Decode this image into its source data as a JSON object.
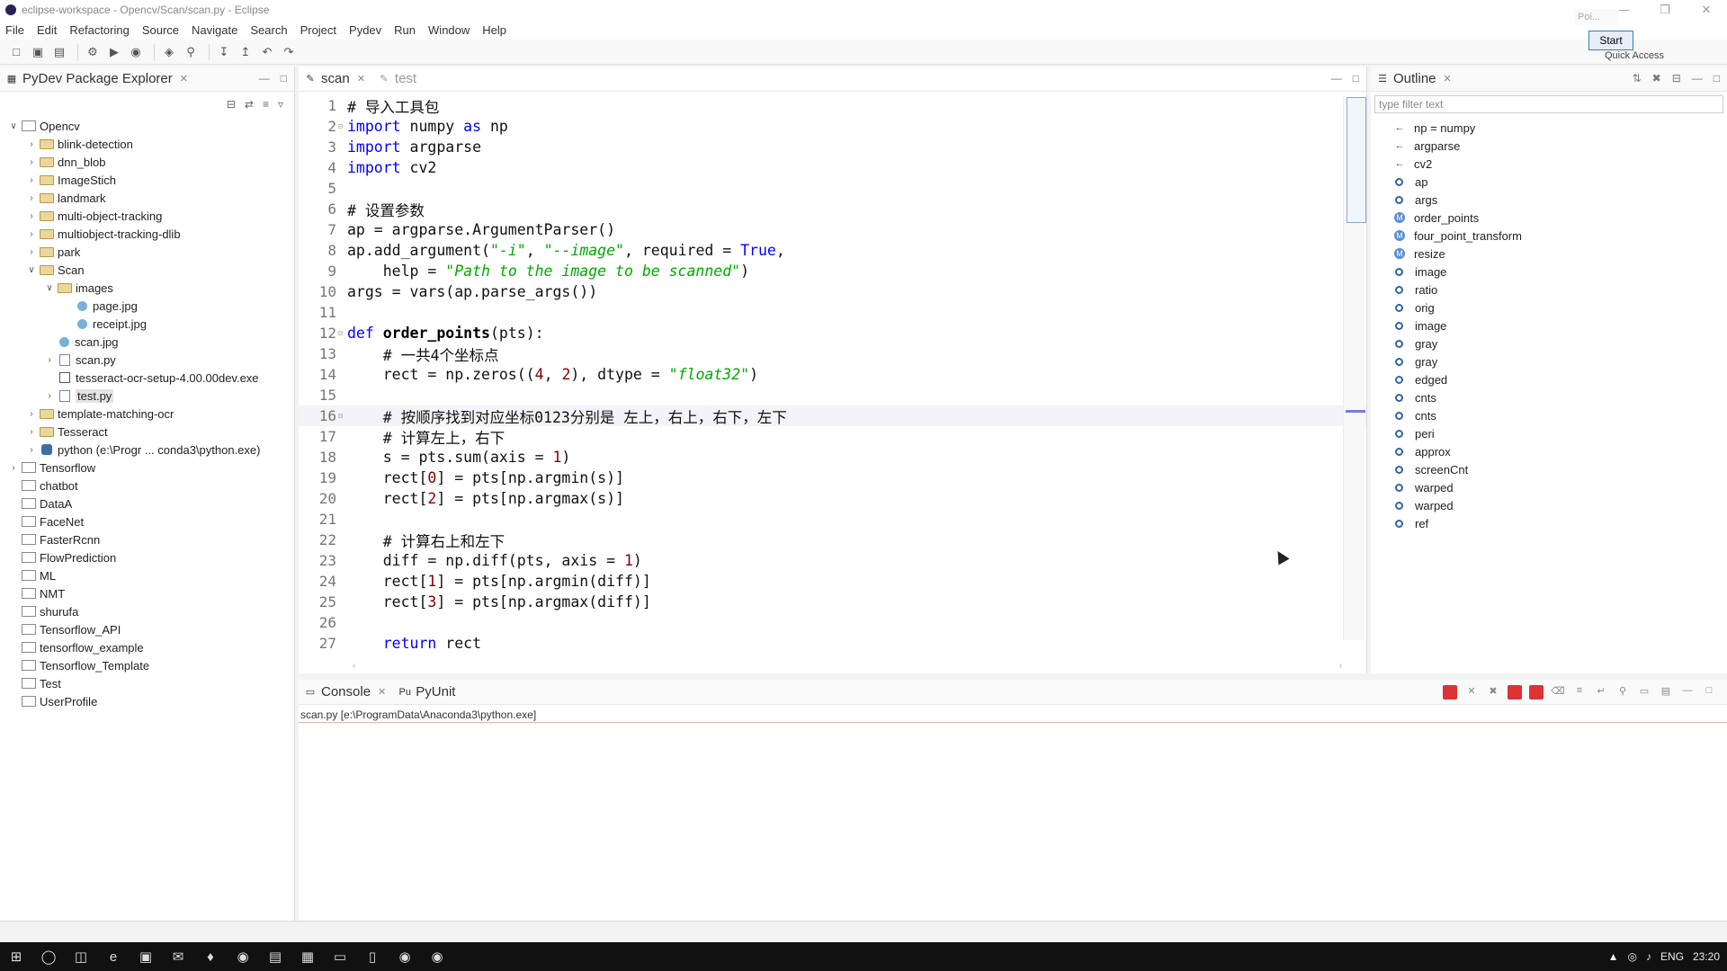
{
  "window": {
    "title": "eclipse-workspace - Opencv/Scan/scan.py - Eclipse"
  },
  "menu": [
    "File",
    "Edit",
    "Refactoring",
    "Source",
    "Navigate",
    "Search",
    "Project",
    "Pydev",
    "Run",
    "Window",
    "Help"
  ],
  "toolbar": {
    "start_label": "Start",
    "quick_access": "Quick Access",
    "poi": "Poi..."
  },
  "explorer": {
    "title": "PyDev Package Explorer",
    "tree": [
      {
        "label": "Opencv",
        "depth": 0,
        "icon": "project",
        "arrow": "expanded"
      },
      {
        "label": "blink-detection",
        "depth": 1,
        "icon": "folder",
        "arrow": "collapsed"
      },
      {
        "label": "dnn_blob",
        "depth": 1,
        "icon": "folder",
        "arrow": "collapsed"
      },
      {
        "label": "ImageStich",
        "depth": 1,
        "icon": "folder",
        "arrow": "collapsed"
      },
      {
        "label": "landmark",
        "depth": 1,
        "icon": "folder",
        "arrow": "collapsed"
      },
      {
        "label": "multi-object-tracking",
        "depth": 1,
        "icon": "folder",
        "arrow": "collapsed"
      },
      {
        "label": "multiobject-tracking-dlib",
        "depth": 1,
        "icon": "folder",
        "arrow": "collapsed"
      },
      {
        "label": "park",
        "depth": 1,
        "icon": "folder",
        "arrow": "collapsed"
      },
      {
        "label": "Scan",
        "depth": 1,
        "icon": "folder",
        "arrow": "expanded"
      },
      {
        "label": "images",
        "depth": 2,
        "icon": "folder",
        "arrow": "expanded"
      },
      {
        "label": "page.jpg",
        "depth": 3,
        "icon": "file-img",
        "arrow": "none"
      },
      {
        "label": "receipt.jpg",
        "depth": 3,
        "icon": "file-img",
        "arrow": "none"
      },
      {
        "label": "scan.jpg",
        "depth": 2,
        "icon": "file-img",
        "arrow": "none"
      },
      {
        "label": "scan.py",
        "depth": 2,
        "icon": "file-py",
        "arrow": "collapsed"
      },
      {
        "label": "tesseract-ocr-setup-4.00.00dev.exe",
        "depth": 2,
        "icon": "file-exe",
        "arrow": "none"
      },
      {
        "label": "test.py",
        "depth": 2,
        "icon": "file-py",
        "arrow": "collapsed",
        "selected": true
      },
      {
        "label": "template-matching-ocr",
        "depth": 1,
        "icon": "folder",
        "arrow": "collapsed"
      },
      {
        "label": "Tesseract",
        "depth": 1,
        "icon": "folder",
        "arrow": "collapsed"
      },
      {
        "label": "python  (e:\\Progr ... conda3\\python.exe)",
        "depth": 1,
        "icon": "python",
        "arrow": "collapsed"
      },
      {
        "label": "Tensorflow",
        "depth": 0,
        "icon": "project",
        "arrow": "collapsed"
      },
      {
        "label": "chatbot",
        "depth": 0,
        "icon": "project",
        "arrow": "none"
      },
      {
        "label": "DataA",
        "depth": 0,
        "icon": "project",
        "arrow": "none"
      },
      {
        "label": "FaceNet",
        "depth": 0,
        "icon": "project",
        "arrow": "none"
      },
      {
        "label": "FasterRcnn",
        "depth": 0,
        "icon": "project",
        "arrow": "none"
      },
      {
        "label": "FlowPrediction",
        "depth": 0,
        "icon": "project",
        "arrow": "none"
      },
      {
        "label": "ML",
        "depth": 0,
        "icon": "project",
        "arrow": "none"
      },
      {
        "label": "NMT",
        "depth": 0,
        "icon": "project",
        "arrow": "none"
      },
      {
        "label": "shurufa",
        "depth": 0,
        "icon": "project",
        "arrow": "none"
      },
      {
        "label": "Tensorflow_API",
        "depth": 0,
        "icon": "project",
        "arrow": "none"
      },
      {
        "label": "tensorflow_example",
        "depth": 0,
        "icon": "project",
        "arrow": "none"
      },
      {
        "label": "Tensorflow_Template",
        "depth": 0,
        "icon": "project",
        "arrow": "none"
      },
      {
        "label": "Test",
        "depth": 0,
        "icon": "project",
        "arrow": "none"
      },
      {
        "label": "UserProfile",
        "depth": 0,
        "icon": "project",
        "arrow": "none"
      }
    ]
  },
  "editor": {
    "tabs": [
      {
        "label": "scan",
        "active": true
      },
      {
        "label": "test",
        "active": false
      }
    ],
    "lines": [
      {
        "n": "1",
        "tokens": [
          [
            "c",
            "# 导入工具包"
          ]
        ]
      },
      {
        "n": "2",
        "fold": true,
        "tokens": [
          [
            "k",
            "import"
          ],
          [
            "t",
            " numpy "
          ],
          [
            "k",
            "as"
          ],
          [
            "t",
            " np"
          ]
        ]
      },
      {
        "n": "3",
        "tokens": [
          [
            "k",
            "import"
          ],
          [
            "t",
            " argparse"
          ]
        ]
      },
      {
        "n": "4",
        "tokens": [
          [
            "k",
            "import"
          ],
          [
            "t",
            " cv2"
          ]
        ]
      },
      {
        "n": "5",
        "tokens": []
      },
      {
        "n": "6",
        "tokens": [
          [
            "c",
            "# 设置参数"
          ]
        ]
      },
      {
        "n": "7",
        "tokens": [
          [
            "t",
            "ap = argparse.ArgumentParser()"
          ]
        ]
      },
      {
        "n": "8",
        "tokens": [
          [
            "t",
            "ap.add_argument("
          ],
          [
            "s",
            "\"-i\""
          ],
          [
            "t",
            ", "
          ],
          [
            "s",
            "\"--image\""
          ],
          [
            "t",
            ", required = "
          ],
          [
            "b",
            "True"
          ],
          [
            "t",
            ","
          ]
        ]
      },
      {
        "n": "9",
        "tokens": [
          [
            "t",
            "    help = "
          ],
          [
            "s",
            "\"Path to the image to be scanned\""
          ],
          [
            "t",
            ")"
          ]
        ]
      },
      {
        "n": "10",
        "tokens": [
          [
            "t",
            "args = vars(ap.parse_args())"
          ]
        ]
      },
      {
        "n": "11",
        "tokens": []
      },
      {
        "n": "12",
        "fold": true,
        "tokens": [
          [
            "k",
            "def"
          ],
          [
            "t",
            " "
          ],
          [
            "f",
            "order_points"
          ],
          [
            "t",
            "(pts):"
          ]
        ]
      },
      {
        "n": "13",
        "tokens": [
          [
            "t",
            "    "
          ],
          [
            "c",
            "# 一共4个坐标点"
          ]
        ]
      },
      {
        "n": "14",
        "tokens": [
          [
            "t",
            "    rect = np.zeros(("
          ],
          [
            "n",
            "4"
          ],
          [
            "t",
            ", "
          ],
          [
            "n",
            "2"
          ],
          [
            "t",
            "), dtype = "
          ],
          [
            "s",
            "\"float32\""
          ],
          [
            "t",
            ")"
          ]
        ]
      },
      {
        "n": "15",
        "tokens": []
      },
      {
        "n": "16",
        "fold": true,
        "current": true,
        "tokens": [
          [
            "t",
            "    "
          ],
          [
            "c",
            "# 按顺序找到对应坐标0123分别是 左上，右上，右下，左下"
          ]
        ]
      },
      {
        "n": "17",
        "tokens": [
          [
            "t",
            "    "
          ],
          [
            "c",
            "# 计算左上，右下"
          ]
        ]
      },
      {
        "n": "18",
        "tokens": [
          [
            "t",
            "    s = pts.sum(axis = "
          ],
          [
            "n",
            "1"
          ],
          [
            "t",
            ")"
          ]
        ]
      },
      {
        "n": "19",
        "tokens": [
          [
            "t",
            "    rect["
          ],
          [
            "n",
            "0"
          ],
          [
            "t",
            "] = pts[np.argmin(s)]"
          ]
        ]
      },
      {
        "n": "20",
        "tokens": [
          [
            "t",
            "    rect["
          ],
          [
            "n",
            "2"
          ],
          [
            "t",
            "] = pts[np.argmax(s)]"
          ]
        ]
      },
      {
        "n": "21",
        "tokens": []
      },
      {
        "n": "22",
        "tokens": [
          [
            "t",
            "    "
          ],
          [
            "c",
            "# 计算右上和左下"
          ]
        ]
      },
      {
        "n": "23",
        "tokens": [
          [
            "t",
            "    diff = np.diff(pts, axis = "
          ],
          [
            "n",
            "1"
          ],
          [
            "t",
            ")"
          ]
        ]
      },
      {
        "n": "24",
        "tokens": [
          [
            "t",
            "    rect["
          ],
          [
            "n",
            "1"
          ],
          [
            "t",
            "] = pts[np.argmin(diff)]"
          ]
        ]
      },
      {
        "n": "25",
        "tokens": [
          [
            "t",
            "    rect["
          ],
          [
            "n",
            "3"
          ],
          [
            "t",
            "] = pts[np.argmax(diff)]"
          ]
        ]
      },
      {
        "n": "26",
        "tokens": []
      },
      {
        "n": "27",
        "tokens": [
          [
            "t",
            "    "
          ],
          [
            "k",
            "return"
          ],
          [
            "t",
            " rect"
          ]
        ]
      }
    ]
  },
  "outline": {
    "title": "Outline",
    "filter_placeholder": "type filter text",
    "items": [
      {
        "label": "np = numpy",
        "kind": "import"
      },
      {
        "label": "argparse",
        "kind": "import"
      },
      {
        "label": "cv2",
        "kind": "import"
      },
      {
        "label": "ap",
        "kind": "var"
      },
      {
        "label": "args",
        "kind": "var"
      },
      {
        "label": "order_points",
        "kind": "func"
      },
      {
        "label": "four_point_transform",
        "kind": "func"
      },
      {
        "label": "resize",
        "kind": "func"
      },
      {
        "label": "image",
        "kind": "var"
      },
      {
        "label": "ratio",
        "kind": "var"
      },
      {
        "label": "orig",
        "kind": "var"
      },
      {
        "label": "image",
        "kind": "var"
      },
      {
        "label": "gray",
        "kind": "var"
      },
      {
        "label": "gray",
        "kind": "var"
      },
      {
        "label": "edged",
        "kind": "var"
      },
      {
        "label": "cnts",
        "kind": "var"
      },
      {
        "label": "cnts",
        "kind": "var"
      },
      {
        "label": "peri",
        "kind": "var"
      },
      {
        "label": "approx",
        "kind": "var"
      },
      {
        "label": "screenCnt",
        "kind": "var"
      },
      {
        "label": "warped",
        "kind": "var"
      },
      {
        "label": "warped",
        "kind": "var"
      },
      {
        "label": "ref",
        "kind": "var"
      }
    ]
  },
  "console": {
    "tabs": [
      {
        "label": "Console"
      },
      {
        "label": "PyUnit"
      }
    ],
    "command": "scan.py [e:\\ProgramData\\Anaconda3\\python.exe]"
  },
  "taskbar": {
    "lang": "ENG",
    "clock": "23:20"
  },
  "colors": {
    "keyword": "#0000ff",
    "string": "#00aa00",
    "number": "#800000",
    "comment": "#c0c4c8"
  }
}
